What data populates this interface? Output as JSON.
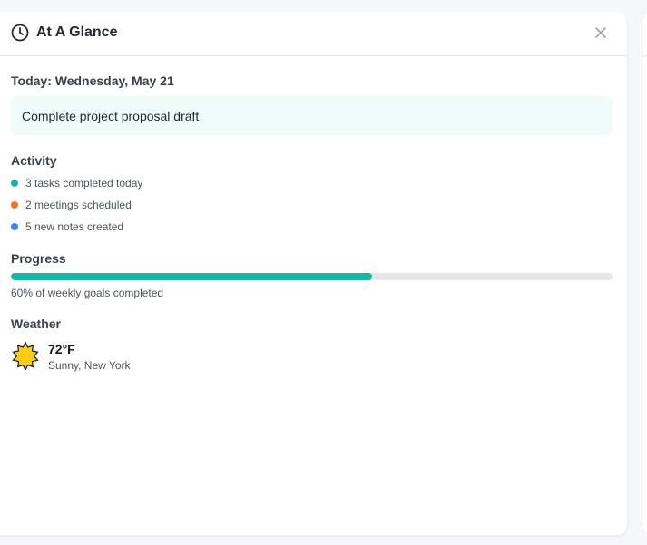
{
  "panel": {
    "title": "At A Glance",
    "title_icon": "clock-icon",
    "close_icon": "close-icon"
  },
  "today": {
    "label": "Today: Wednesday, May 21",
    "task": "Complete project proposal draft"
  },
  "activity": {
    "heading": "Activity",
    "items": [
      {
        "text": "3 tasks completed today",
        "color": "#14b8a6"
      },
      {
        "text": "2 meetings scheduled",
        "color": "#f97316"
      },
      {
        "text": "5 new notes created",
        "color": "#3b82f6"
      }
    ]
  },
  "progress": {
    "heading": "Progress",
    "percent": 60,
    "label": "60% of weekly goals completed",
    "color": "#14b8a6"
  },
  "weather": {
    "heading": "Weather",
    "icon": "sun-icon",
    "temperature": "72°F",
    "description": "Sunny, New York"
  }
}
